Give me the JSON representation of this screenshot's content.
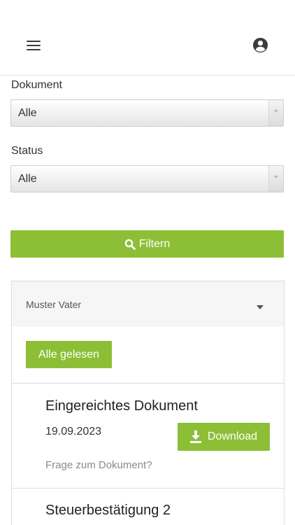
{
  "header": {
    "menu_icon": "hamburger-menu-icon",
    "account_icon": "user-circle-icon"
  },
  "filters": {
    "document_label": "Dokument",
    "document_value": "Alle",
    "status_label": "Status",
    "status_value": "Alle",
    "filter_button_label": "Filtern",
    "filter_icon": "search-icon"
  },
  "group": {
    "name": "Muster Vater",
    "mark_all_read_label": "Alle gelesen",
    "documents": [
      {
        "title": "Eingereichtes Dokument",
        "date": "19.09.2023",
        "download_label": "Download",
        "question_label": "Frage zum Dokument?"
      },
      {
        "title": "Steuerbestätigung 2"
      }
    ]
  },
  "colors": {
    "accent": "#8cbf36",
    "text": "#333333",
    "muted": "#8a8a8a",
    "border": "#dcdcdc"
  }
}
